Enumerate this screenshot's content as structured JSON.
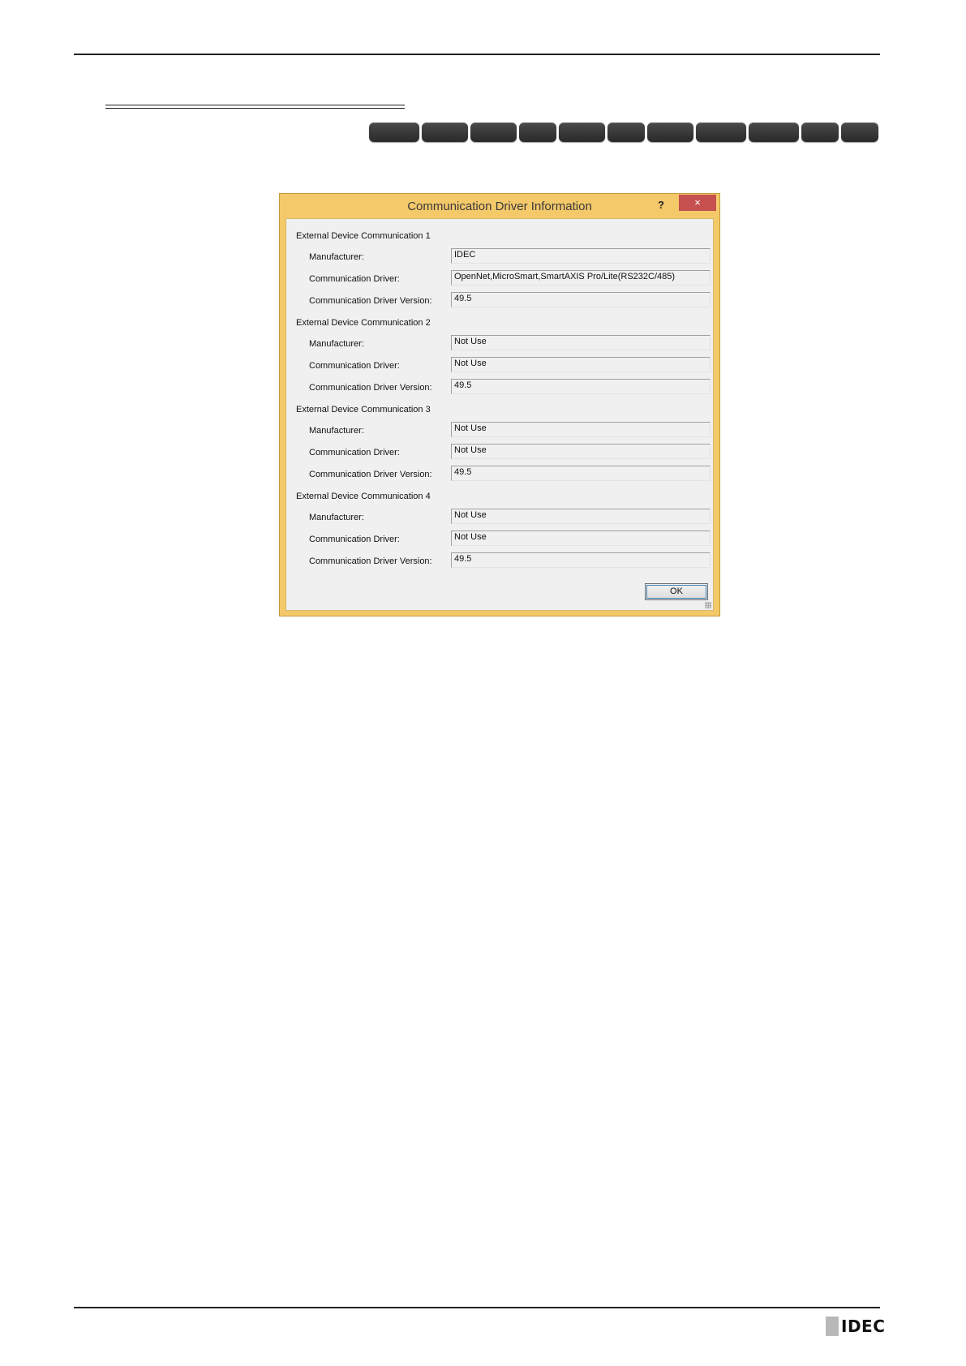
{
  "dialog": {
    "title": "Communication Driver Information",
    "help_label": "?",
    "close_label": "×",
    "ok_label": "OK",
    "sections": [
      {
        "label": "External Device Communication 1",
        "manufacturer_label": "Manufacturer:",
        "manufacturer": "IDEC",
        "driver_label": "Communication Driver:",
        "driver": "OpenNet,MicroSmart,SmartAXIS Pro/Lite(RS232C/485)",
        "version_label": "Communication Driver Version:",
        "version": "49.5"
      },
      {
        "label": "External Device Communication 2",
        "manufacturer_label": "Manufacturer:",
        "manufacturer": "Not Use",
        "driver_label": "Communication Driver:",
        "driver": "Not Use",
        "version_label": "Communication Driver Version:",
        "version": "49.5"
      },
      {
        "label": "External Device Communication 3",
        "manufacturer_label": "Manufacturer:",
        "manufacturer": "Not Use",
        "driver_label": "Communication Driver:",
        "driver": "Not Use",
        "version_label": "Communication Driver Version:",
        "version": "49.5"
      },
      {
        "label": "External Device Communication 4",
        "manufacturer_label": "Manufacturer:",
        "manufacturer": "Not Use",
        "driver_label": "Communication Driver:",
        "driver": "Not Use",
        "version_label": "Communication Driver Version:",
        "version": "49.5"
      }
    ]
  },
  "footer": {
    "logo_text": "IDEC"
  },
  "colors": {
    "dialog_frame": "#f4c96a",
    "close_button": "#c75050",
    "pill": "#333333"
  }
}
